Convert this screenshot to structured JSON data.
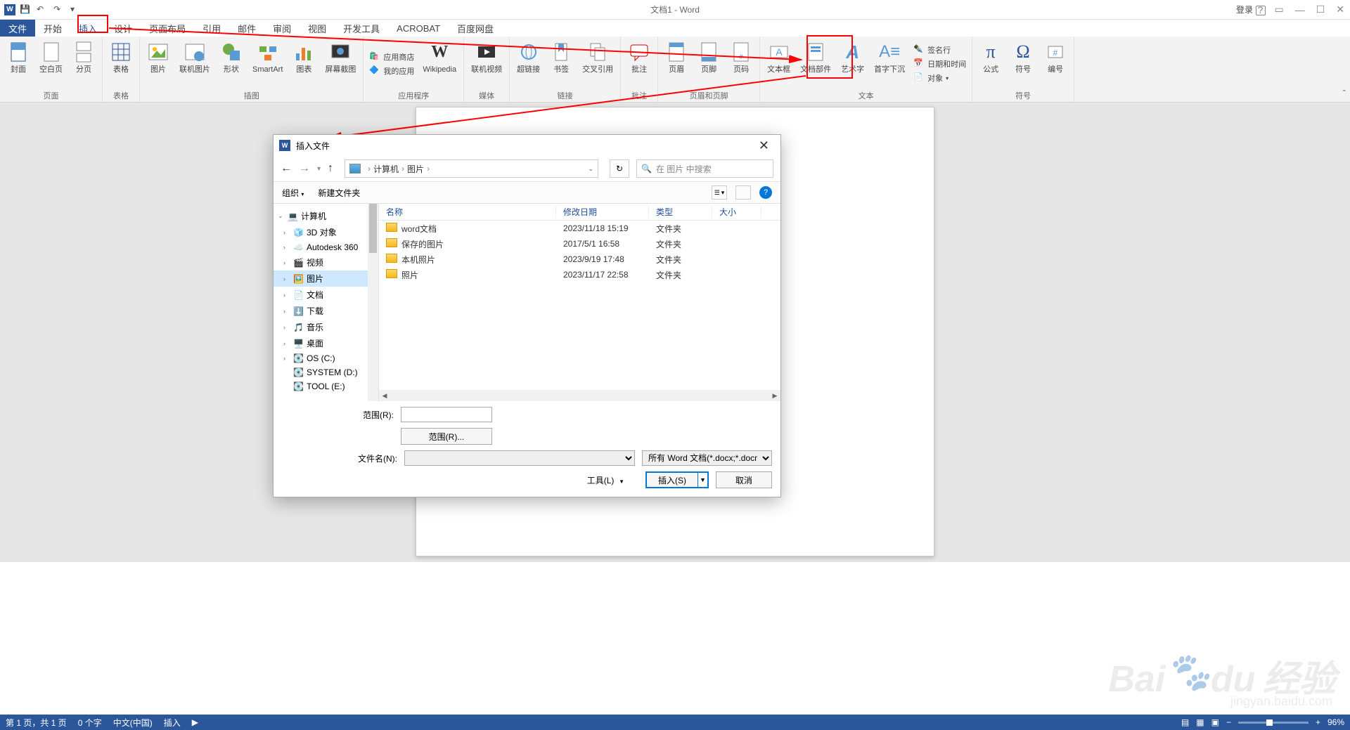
{
  "title": "文档1 - Word",
  "login": "登录",
  "file_tab": "文件",
  "tabs": [
    "开始",
    "插入",
    "设计",
    "页面布局",
    "引用",
    "邮件",
    "审阅",
    "视图",
    "开发工具",
    "ACROBAT",
    "百度网盘"
  ],
  "active_tab_index": 1,
  "ribbon": {
    "groups": [
      {
        "name": "页面",
        "items": [
          "封面",
          "空白页",
          "分页"
        ]
      },
      {
        "name": "表格",
        "items": [
          "表格"
        ]
      },
      {
        "name": "插图",
        "items": [
          "图片",
          "联机图片",
          "形状",
          "SmartArt",
          "图表",
          "屏幕截图"
        ]
      },
      {
        "name": "应用程序",
        "stack": [
          "应用商店",
          "我的应用"
        ],
        "right": "Wikipedia"
      },
      {
        "name": "媒体",
        "items": [
          "联机视频"
        ]
      },
      {
        "name": "链接",
        "items": [
          "超链接",
          "书签",
          "交叉引用"
        ]
      },
      {
        "name": "批注",
        "items": [
          "批注"
        ]
      },
      {
        "name": "页眉和页脚",
        "items": [
          "页眉",
          "页脚",
          "页码"
        ]
      },
      {
        "name": "文本",
        "items": [
          "文本框",
          "文档部件",
          "艺术字",
          "首字下沉"
        ],
        "stack": [
          "签名行",
          "日期和时间",
          "对象"
        ]
      },
      {
        "name": "符号",
        "items": [
          "公式",
          "符号",
          "编号"
        ]
      }
    ]
  },
  "dialog": {
    "title": "插入文件",
    "breadcrumb": [
      "计算机",
      "图片"
    ],
    "search_placeholder": "在 图片 中搜索",
    "toolbar": {
      "organize": "组织",
      "new_folder": "新建文件夹"
    },
    "tree": [
      {
        "label": "计算机",
        "level": 0,
        "exp": "v",
        "icon": "computer"
      },
      {
        "label": "3D 对象",
        "level": 1,
        "exp": ">",
        "icon": "3d"
      },
      {
        "label": "Autodesk 360",
        "level": 1,
        "exp": ">",
        "icon": "cloud"
      },
      {
        "label": "视频",
        "level": 1,
        "exp": ">",
        "icon": "video"
      },
      {
        "label": "图片",
        "level": 1,
        "exp": ">",
        "icon": "picture",
        "sel": true
      },
      {
        "label": "文档",
        "level": 1,
        "exp": ">",
        "icon": "doc"
      },
      {
        "label": "下载",
        "level": 1,
        "exp": ">",
        "icon": "download"
      },
      {
        "label": "音乐",
        "level": 1,
        "exp": ">",
        "icon": "music"
      },
      {
        "label": "桌面",
        "level": 1,
        "exp": ">",
        "icon": "desktop"
      },
      {
        "label": "OS (C:)",
        "level": 1,
        "exp": ">",
        "icon": "disk"
      },
      {
        "label": "SYSTEM (D:)",
        "level": 1,
        "exp": "",
        "icon": "disk"
      },
      {
        "label": "TOOL (E:)",
        "level": 1,
        "exp": "",
        "icon": "disk"
      }
    ],
    "columns": [
      "名称",
      "修改日期",
      "类型",
      "大小"
    ],
    "rows": [
      {
        "name": "word文档",
        "date": "2023/11/18 15:19",
        "type": "文件夹"
      },
      {
        "name": "保存的图片",
        "date": "2017/5/1 16:58",
        "type": "文件夹"
      },
      {
        "name": "本机照片",
        "date": "2023/9/19 17:48",
        "type": "文件夹"
      },
      {
        "name": "照片",
        "date": "2023/11/17 22:58",
        "type": "文件夹"
      }
    ],
    "footer": {
      "range_label": "范围(R):",
      "range_btn": "范围(R)...",
      "filename_label": "文件名(N):",
      "filter": "所有 Word 文档(*.docx;*.docm",
      "tools": "工具(L)",
      "insert": "插入(S)",
      "cancel": "取消"
    }
  },
  "status": {
    "page": "第 1 页，共 1 页",
    "words": "0 个字",
    "lang": "中文(中国)",
    "mode": "插入",
    "zoom": "96%"
  },
  "watermark": "Baidu 经验",
  "watermark_sub": "jingyan.baidu.com"
}
